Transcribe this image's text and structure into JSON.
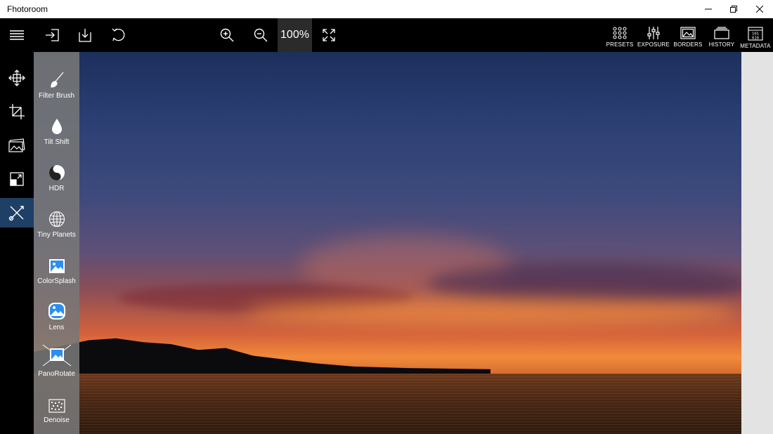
{
  "window": {
    "title": "Fhotoroom",
    "minimize_icon": "minimize-icon",
    "maximize_icon": "restore-icon",
    "close_icon": "close-icon"
  },
  "toolbar": {
    "left": [
      {
        "name": "menu-icon"
      },
      {
        "name": "import-icon"
      },
      {
        "name": "save-icon"
      },
      {
        "name": "rotate-icon"
      }
    ],
    "zoom_in": "zoom-in-icon",
    "zoom_out": "zoom-out-icon",
    "zoom_level": "100%",
    "fit_screen": "fit-screen-icon",
    "right": [
      {
        "label": "PRESETS",
        "icon": "presets-icon"
      },
      {
        "label": "EXPOSURE",
        "icon": "exposure-icon"
      },
      {
        "label": "BORDERS",
        "icon": "borders-icon"
      },
      {
        "label": "HISTORY",
        "icon": "history-icon"
      },
      {
        "label": "METADATA",
        "icon": "metadata-icon"
      }
    ]
  },
  "left_rail": [
    {
      "name": "move-icon"
    },
    {
      "name": "crop-icon"
    },
    {
      "name": "adjust-photo-icon"
    },
    {
      "name": "resize-icon"
    },
    {
      "name": "tools-icon",
      "active": true
    }
  ],
  "tools_panel": {
    "items": [
      {
        "label": "Filter Brush",
        "icon": "brush-icon"
      },
      {
        "label": "Tilt Shift",
        "icon": "droplet-icon"
      },
      {
        "label": "HDR",
        "icon": "yin-yang-icon"
      },
      {
        "label": "Tiny Planets",
        "icon": "globe-icon"
      },
      {
        "label": "ColorSplash",
        "icon": "image-icon"
      },
      {
        "label": "Lens",
        "icon": "lens-icon"
      },
      {
        "label": "PanoRotate",
        "icon": "pano-rotate-icon"
      },
      {
        "label": "Denoise",
        "icon": "denoise-icon"
      }
    ]
  },
  "colors": {
    "accent": "#1e3f66",
    "toolbar_bg": "#000000",
    "panel_bg": "#787878"
  }
}
